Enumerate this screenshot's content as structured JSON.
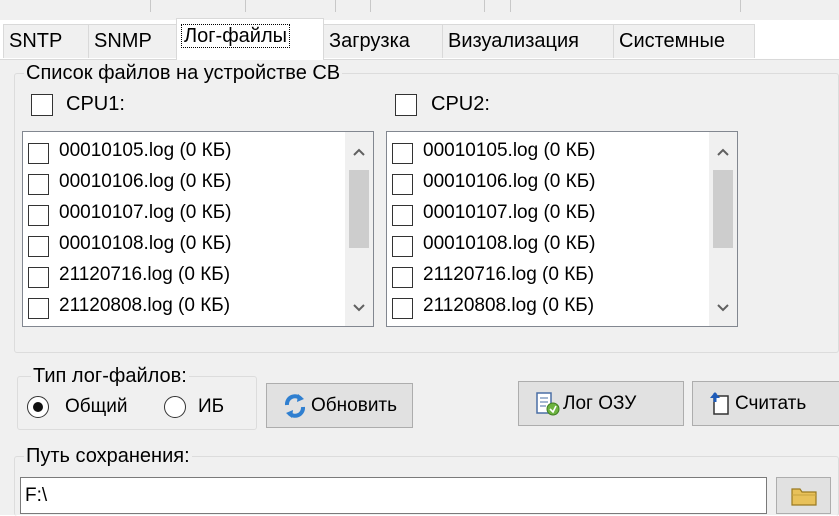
{
  "tabs": [
    "SNTP",
    "SNMP",
    "Лог-файлы",
    "Загрузка",
    "Визуализация",
    "Системные"
  ],
  "active_tab": "Лог-файлы",
  "files_group": {
    "title": "Список файлов на устройстве СВ",
    "cpu1_label": "CPU1:",
    "cpu2_label": "CPU2:",
    "cpu1_files": [
      "00010105.log (0 КБ)",
      "00010106.log (0 КБ)",
      "00010107.log (0 КБ)",
      "00010108.log (0 КБ)",
      "21120716.log (0 КБ)",
      "21120808.log (0 КБ)"
    ],
    "cpu2_files": [
      "00010105.log (0 КБ)",
      "00010106.log (0 КБ)",
      "00010107.log (0 КБ)",
      "00010108.log (0 КБ)",
      "21120716.log (0 КБ)",
      "21120808.log (0 КБ)"
    ]
  },
  "log_type": {
    "title": "Тип лог-файлов:",
    "option_common": "Общий",
    "option_ib": "ИБ",
    "selected": "Общий"
  },
  "buttons": {
    "refresh": "Обновить",
    "ram_log": "Лог ОЗУ",
    "read": "Считать"
  },
  "save_path": {
    "title": "Путь сохранения:",
    "value": "F:\\"
  },
  "icons": {
    "refresh": "refresh-icon",
    "ram_log": "ram-log-icon",
    "read": "read-icon",
    "folder": "folder-icon",
    "scroll_up": "chevron-up-icon",
    "scroll_down": "chevron-down-icon"
  },
  "colors": {
    "panel_bg": "#f0f0f0",
    "button_bg": "#e1e1e1",
    "refresh_blue": "#2f7fd0",
    "folder_yellow": "#e8c15a"
  }
}
